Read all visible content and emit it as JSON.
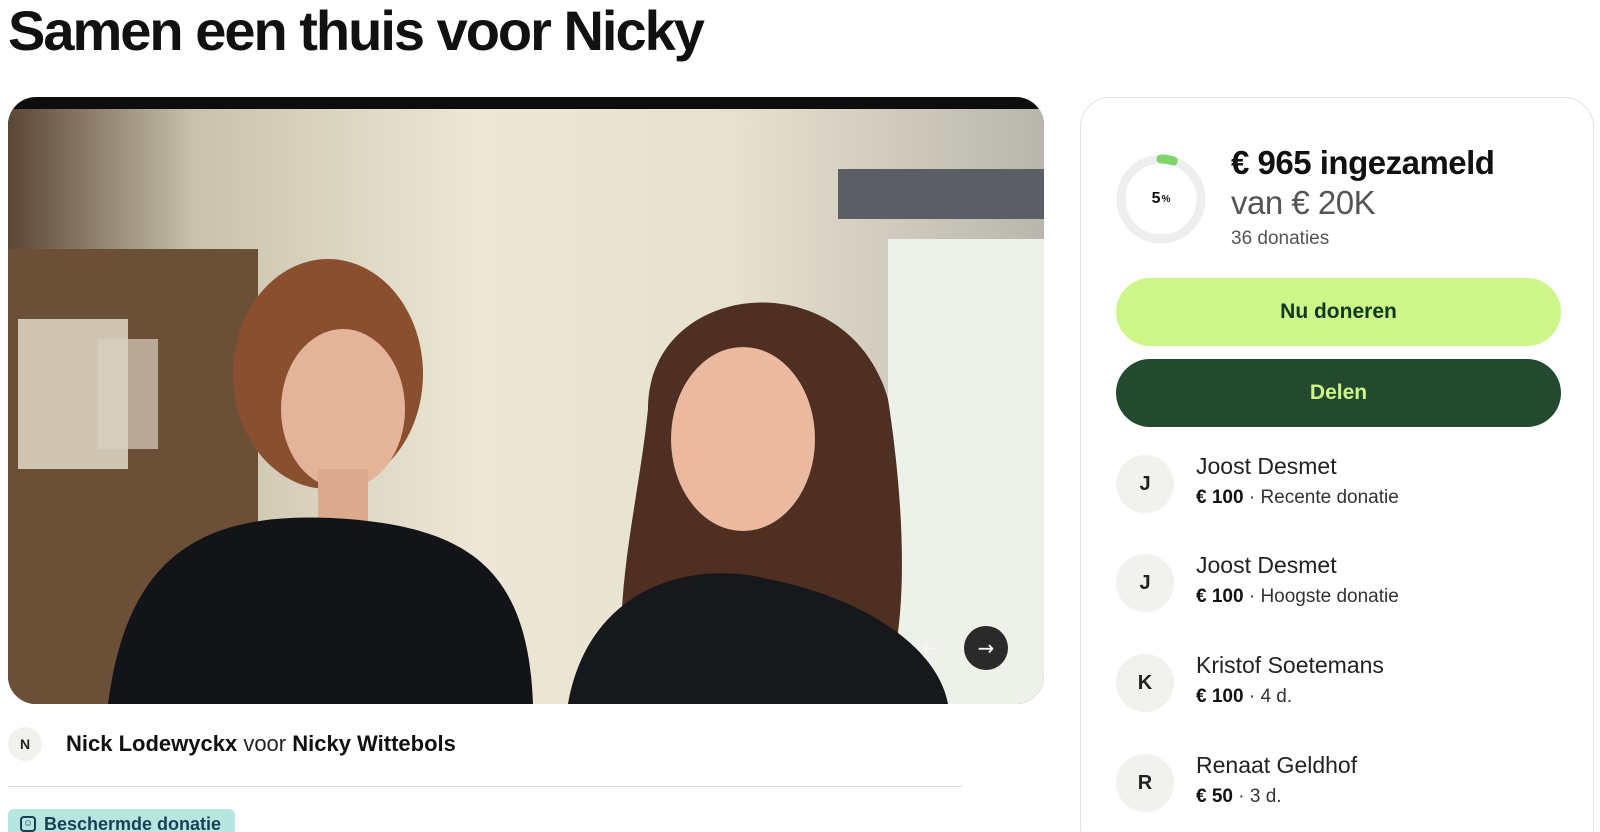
{
  "page": {
    "title": "Samen een thuis voor Nicky"
  },
  "hero": {
    "slides_total": 3,
    "active_slide": 1,
    "prev_icon": "arrow-left-icon",
    "next_icon": "arrow-right-icon"
  },
  "organizer": {
    "avatar_initial": "N",
    "name": "Nick Lodewyckx",
    "connector": "voor",
    "beneficiary": "Nicky Wittebols"
  },
  "badge": {
    "label": "Beschermde donatie",
    "icon": "shield-icon"
  },
  "fundraiser": {
    "progress_percent": "5",
    "progress_fraction": 0.05,
    "percent_sign": "%",
    "raised": "€ 965 ingezameld",
    "goal": "van € 20K",
    "donations_count": "36 donaties"
  },
  "actions": {
    "donate_label": "Nu doneren",
    "share_label": "Delen"
  },
  "donors": [
    {
      "initial": "J",
      "name": "Joost Desmet",
      "amount": "€ 100",
      "detail": "Recente donatie"
    },
    {
      "initial": "J",
      "name": "Joost Desmet",
      "amount": "€ 100",
      "detail": "Hoogste donatie"
    },
    {
      "initial": "K",
      "name": "Kristof Soetemans",
      "amount": "€ 100",
      "detail": "4 d."
    },
    {
      "initial": "R",
      "name": "Renaat Geldhof",
      "amount": "€ 50",
      "detail": "3 d."
    }
  ],
  "colors": {
    "donate_bg": "#cdf58a",
    "share_bg": "#234a2e",
    "progress": "#7fd46a",
    "badge_bg": "#b7e6e1"
  }
}
